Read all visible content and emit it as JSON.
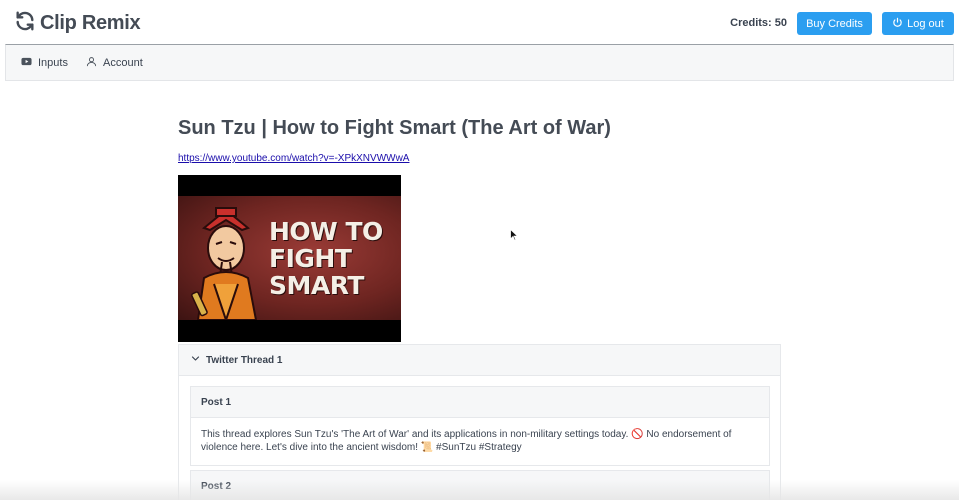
{
  "app": {
    "name": "Clip Remix",
    "logo_icon": "refresh-icon"
  },
  "header": {
    "credits_text": "Credits: 50",
    "buy_credits_label": "Buy Credits",
    "logout_label": "Log out",
    "logout_icon": "power-icon",
    "accent_color": "#2b9ef0"
  },
  "nav": {
    "tabs": [
      {
        "label": "Inputs",
        "icon": "video-icon"
      },
      {
        "label": "Account",
        "icon": "user-icon"
      }
    ]
  },
  "video": {
    "title": "Sun Tzu | How to Fight Smart (The Art of War)",
    "url": "https://www.youtube.com/watch?v=-XPkXNVWWwA",
    "thumbnail_text": [
      "HOW TO",
      "FIGHT",
      "SMART"
    ]
  },
  "thread": {
    "label": "Twitter Thread 1",
    "posts": [
      {
        "label": "Post 1",
        "text": "This thread explores Sun Tzu's 'The Art of War' and its applications in non-military settings today. 🚫 No endorsement of violence here. Let's dive into the ancient wisdom! 📜 #SunTzu #Strategy"
      },
      {
        "label": "Post 2",
        "text": ""
      }
    ]
  }
}
